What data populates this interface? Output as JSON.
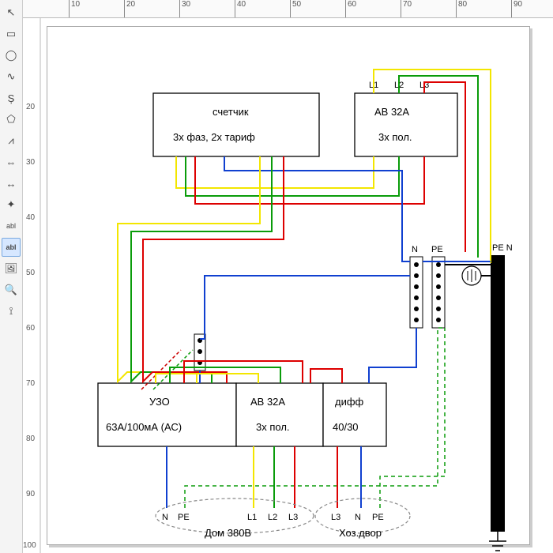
{
  "app": {
    "ruler_major": [
      10,
      20,
      30,
      40,
      50,
      60,
      70,
      80,
      90
    ]
  },
  "toolbox": {
    "items": [
      {
        "name": "pointer",
        "glyph": "↖"
      },
      {
        "name": "rect",
        "glyph": "▭"
      },
      {
        "name": "ellipse",
        "glyph": "◯"
      },
      {
        "name": "freehand",
        "glyph": "∿"
      },
      {
        "name": "bezier",
        "glyph": "Ș"
      },
      {
        "name": "polygon",
        "glyph": "⬠"
      },
      {
        "name": "polyline",
        "glyph": "⩘"
      },
      {
        "name": "line",
        "glyph": "⇔"
      },
      {
        "name": "dimension",
        "glyph": "↔"
      },
      {
        "name": "crosshair",
        "glyph": "✦"
      },
      {
        "name": "text-plain",
        "glyph": "abl"
      },
      {
        "name": "text-box",
        "glyph": "abl",
        "sel": true
      },
      {
        "name": "image",
        "glyph": "🖼"
      },
      {
        "name": "zoom",
        "glyph": "🔍"
      },
      {
        "name": "measure",
        "glyph": "⟟"
      }
    ]
  },
  "blocks": {
    "meter": {
      "line1": "счетчик",
      "line2": "3х фаз, 2х тариф"
    },
    "breaker1": {
      "line1": "АВ 32А",
      "line2": "3х пол."
    },
    "uzo": {
      "line1": "УЗО",
      "line2": "63А/100мА (АС)"
    },
    "breaker2": {
      "line1": "АВ 32А",
      "line2": "3х пол."
    },
    "diff": {
      "line1": "дифф",
      "line2": "40/30"
    }
  },
  "labels": {
    "L1": "L1",
    "L2": "L2",
    "L3": "L3",
    "N": "N",
    "PE": "PE",
    "PEN": "PE N",
    "out1": "Дом 380В",
    "out2": "Хоз.двор",
    "outN": "N",
    "outPE": "PE",
    "outL1": "L1",
    "outL2": "L2",
    "outL3": "L3"
  },
  "colors": {
    "L1": "#f3e600",
    "L2": "#0a9c0a",
    "L3": "#d00000",
    "N": "#1040d0",
    "PE": "#0a9c0a"
  }
}
